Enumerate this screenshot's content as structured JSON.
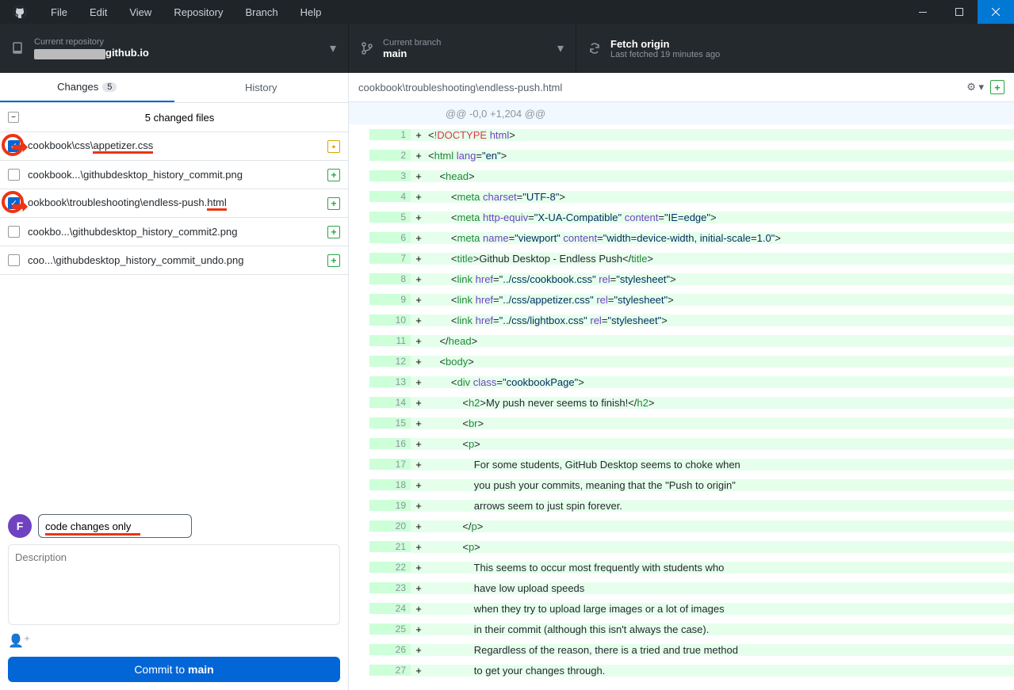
{
  "menu": [
    "File",
    "Edit",
    "View",
    "Repository",
    "Branch",
    "Help"
  ],
  "toolbar": {
    "repo": {
      "label": "Current repository",
      "value_suffix": "github.io"
    },
    "branch": {
      "label": "Current branch",
      "value": "main"
    },
    "fetch": {
      "label": "Fetch origin",
      "value": "Last fetched 19 minutes ago"
    }
  },
  "tabs": {
    "changes": "Changes",
    "changes_count": "5",
    "history": "History"
  },
  "files_header": "5 changed files",
  "files": [
    {
      "name": "cookbook\\css\\appetizer.css",
      "checked": true,
      "icon": "mod",
      "ul": "appetizer.css",
      "circle": true
    },
    {
      "name": "cookbook...\\githubdesktop_history_commit.png",
      "checked": false,
      "icon": "add"
    },
    {
      "name": "ookbook\\troubleshooting\\endless-push.html",
      "checked": true,
      "icon": "add",
      "ul": "html",
      "circle": true
    },
    {
      "name": "cookbo...\\githubdesktop_history_commit2.png",
      "checked": false,
      "icon": "add"
    },
    {
      "name": "coo...\\githubdesktop_history_commit_undo.png",
      "checked": false,
      "icon": "add"
    }
  ],
  "commit": {
    "summary": "code changes only",
    "desc_placeholder": "Description",
    "button_prefix": "Commit to ",
    "button_branch": "main"
  },
  "diff": {
    "path": "cookbook\\troubleshooting\\endless-push.html",
    "hunk": "@@ -0,0 +1,204 @@",
    "lines": [
      {
        "n": 1,
        "tokens": [
          [
            "txt",
            "<"
          ],
          [
            "kw",
            "!DOCTYPE"
          ],
          [
            "txt",
            " "
          ],
          [
            "attr",
            "html"
          ],
          [
            "txt",
            ">"
          ]
        ]
      },
      {
        "n": 2,
        "tokens": [
          [
            "txt",
            "<"
          ],
          [
            "tag",
            "html"
          ],
          [
            "txt",
            " "
          ],
          [
            "attr",
            "lang"
          ],
          [
            "txt",
            "="
          ],
          [
            "str",
            "\"en\""
          ],
          [
            "txt",
            ">"
          ]
        ]
      },
      {
        "n": 3,
        "tokens": [
          [
            "txt",
            "    <"
          ],
          [
            "tag",
            "head"
          ],
          [
            "txt",
            ">"
          ]
        ]
      },
      {
        "n": 4,
        "tokens": [
          [
            "txt",
            "        <"
          ],
          [
            "tag",
            "meta"
          ],
          [
            "txt",
            " "
          ],
          [
            "attr",
            "charset"
          ],
          [
            "txt",
            "="
          ],
          [
            "str",
            "\"UTF-8\""
          ],
          [
            "txt",
            ">"
          ]
        ]
      },
      {
        "n": 5,
        "tokens": [
          [
            "txt",
            "        <"
          ],
          [
            "tag",
            "meta"
          ],
          [
            "txt",
            " "
          ],
          [
            "attr",
            "http-equiv"
          ],
          [
            "txt",
            "="
          ],
          [
            "str",
            "\"X-UA-Compatible\""
          ],
          [
            "txt",
            " "
          ],
          [
            "attr",
            "content"
          ],
          [
            "txt",
            "="
          ],
          [
            "str",
            "\"IE=edge\""
          ],
          [
            "txt",
            ">"
          ]
        ]
      },
      {
        "n": 6,
        "tokens": [
          [
            "txt",
            "        <"
          ],
          [
            "tag",
            "meta"
          ],
          [
            "txt",
            " "
          ],
          [
            "attr",
            "name"
          ],
          [
            "txt",
            "="
          ],
          [
            "str",
            "\"viewport\""
          ],
          [
            "txt",
            " "
          ],
          [
            "attr",
            "content"
          ],
          [
            "txt",
            "="
          ],
          [
            "str",
            "\"width=device-width, initial-scale=1.0\""
          ],
          [
            "txt",
            ">"
          ]
        ]
      },
      {
        "n": 7,
        "tokens": [
          [
            "txt",
            "        <"
          ],
          [
            "tag",
            "title"
          ],
          [
            "txt",
            ">Github Desktop - Endless Push</"
          ],
          [
            "tag",
            "title"
          ],
          [
            "txt",
            ">"
          ]
        ]
      },
      {
        "n": 8,
        "tokens": [
          [
            "txt",
            "        <"
          ],
          [
            "tag",
            "link"
          ],
          [
            "txt",
            " "
          ],
          [
            "attr",
            "href"
          ],
          [
            "txt",
            "="
          ],
          [
            "str",
            "\"../css/cookbook.css\""
          ],
          [
            "txt",
            " "
          ],
          [
            "attr",
            "rel"
          ],
          [
            "txt",
            "="
          ],
          [
            "str",
            "\"stylesheet\""
          ],
          [
            "txt",
            ">"
          ]
        ]
      },
      {
        "n": 9,
        "tokens": [
          [
            "txt",
            "        <"
          ],
          [
            "tag",
            "link"
          ],
          [
            "txt",
            " "
          ],
          [
            "attr",
            "href"
          ],
          [
            "txt",
            "="
          ],
          [
            "str",
            "\"../css/appetizer.css\""
          ],
          [
            "txt",
            " "
          ],
          [
            "attr",
            "rel"
          ],
          [
            "txt",
            "="
          ],
          [
            "str",
            "\"stylesheet\""
          ],
          [
            "txt",
            ">"
          ]
        ]
      },
      {
        "n": 10,
        "tokens": [
          [
            "txt",
            "        <"
          ],
          [
            "tag",
            "link"
          ],
          [
            "txt",
            " "
          ],
          [
            "attr",
            "href"
          ],
          [
            "txt",
            "="
          ],
          [
            "str",
            "\"../css/lightbox.css\""
          ],
          [
            "txt",
            " "
          ],
          [
            "attr",
            "rel"
          ],
          [
            "txt",
            "="
          ],
          [
            "str",
            "\"stylesheet\""
          ],
          [
            "txt",
            ">"
          ]
        ]
      },
      {
        "n": 11,
        "tokens": [
          [
            "txt",
            "    </"
          ],
          [
            "tag",
            "head"
          ],
          [
            "txt",
            ">"
          ]
        ]
      },
      {
        "n": 12,
        "tokens": [
          [
            "txt",
            "    <"
          ],
          [
            "tag",
            "body"
          ],
          [
            "txt",
            ">"
          ]
        ]
      },
      {
        "n": 13,
        "tokens": [
          [
            "txt",
            "        <"
          ],
          [
            "tag",
            "div"
          ],
          [
            "txt",
            " "
          ],
          [
            "attr",
            "class"
          ],
          [
            "txt",
            "="
          ],
          [
            "str",
            "\"cookbookPage\""
          ],
          [
            "txt",
            ">"
          ]
        ]
      },
      {
        "n": 14,
        "tokens": [
          [
            "txt",
            "            <"
          ],
          [
            "tag",
            "h2"
          ],
          [
            "txt",
            ">My push never seems to finish!</"
          ],
          [
            "tag",
            "h2"
          ],
          [
            "txt",
            ">"
          ]
        ]
      },
      {
        "n": 15,
        "tokens": [
          [
            "txt",
            "            <"
          ],
          [
            "tag",
            "br"
          ],
          [
            "txt",
            ">"
          ]
        ]
      },
      {
        "n": 16,
        "tokens": [
          [
            "txt",
            "            <"
          ],
          [
            "tag",
            "p"
          ],
          [
            "txt",
            ">"
          ]
        ]
      },
      {
        "n": 17,
        "tokens": [
          [
            "txt",
            "                For some students, GitHub Desktop seems to choke when"
          ]
        ]
      },
      {
        "n": 18,
        "tokens": [
          [
            "txt",
            "                you push your commits, meaning that the \"Push to origin\""
          ]
        ]
      },
      {
        "n": 19,
        "tokens": [
          [
            "txt",
            "                arrows seem to just spin forever."
          ]
        ]
      },
      {
        "n": 20,
        "tokens": [
          [
            "txt",
            "            </"
          ],
          [
            "tag",
            "p"
          ],
          [
            "txt",
            ">"
          ]
        ]
      },
      {
        "n": 21,
        "tokens": [
          [
            "txt",
            "            <"
          ],
          [
            "tag",
            "p"
          ],
          [
            "txt",
            ">"
          ]
        ]
      },
      {
        "n": 22,
        "tokens": [
          [
            "txt",
            "                This seems to occur most frequently with students who"
          ]
        ]
      },
      {
        "n": 23,
        "tokens": [
          [
            "txt",
            "                have low upload speeds"
          ]
        ]
      },
      {
        "n": 24,
        "tokens": [
          [
            "txt",
            "                when they try to upload large images or a lot of images"
          ]
        ]
      },
      {
        "n": 25,
        "tokens": [
          [
            "txt",
            "                in their commit (although this isn't always the case)."
          ]
        ]
      },
      {
        "n": 26,
        "tokens": [
          [
            "txt",
            "                Regardless of the reason, there is a tried and true method"
          ]
        ]
      },
      {
        "n": 27,
        "tokens": [
          [
            "txt",
            "                to get your changes through."
          ]
        ]
      }
    ]
  }
}
